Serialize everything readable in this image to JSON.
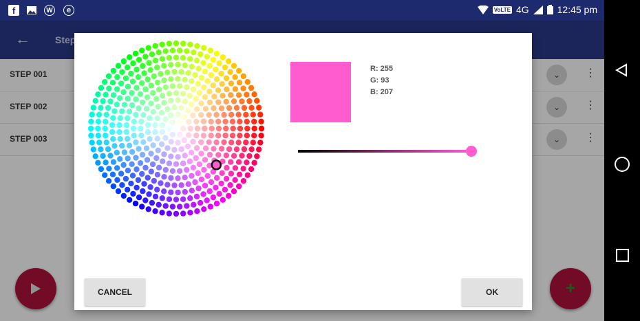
{
  "status_bar": {
    "time": "12:45 pm",
    "network": "4G",
    "volte": "VoLTE",
    "icons": [
      "facebook-icon",
      "image-icon",
      "wordpress-icon",
      "e-app-icon",
      "wifi-icon",
      "signal-icon",
      "battery-icon"
    ]
  },
  "app_bar": {
    "title": "Step"
  },
  "list": {
    "rows": [
      {
        "label": "STEP 001"
      },
      {
        "label": "STEP 002"
      },
      {
        "label": "STEP 003"
      }
    ]
  },
  "dialog": {
    "color": {
      "r": 255,
      "g": 93,
      "b": 207,
      "hex": "#ff5dcf"
    },
    "rgb_text": {
      "r": "R: 255",
      "g": "G: 93",
      "b": "B: 207"
    },
    "brightness": 1.0,
    "cancel_label": "CANCEL",
    "ok_label": "OK"
  },
  "colors": {
    "status_bar": "#1e2a6e",
    "app_bar": "#2b3a8a",
    "fab": "#b0113a",
    "selected": "#ff5dcf"
  }
}
